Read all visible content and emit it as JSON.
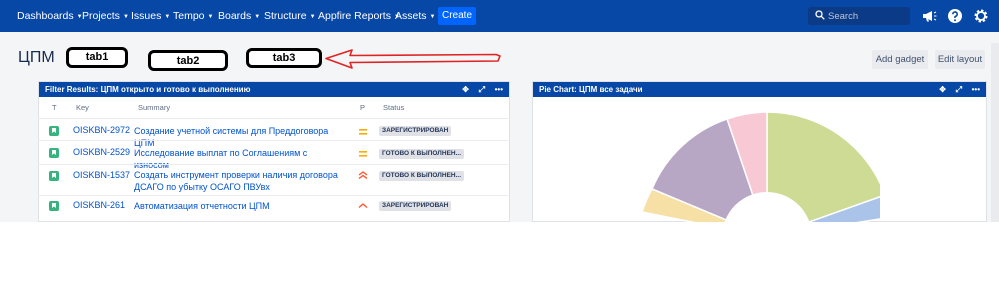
{
  "nav": {
    "items": [
      "Dashboards",
      "Projects",
      "Issues",
      "Tempo",
      "Boards",
      "Structure",
      "Appfire Reports",
      "Assets"
    ],
    "create_label": "Create",
    "search_placeholder": "Search"
  },
  "dashboard": {
    "title": "ЦПМ",
    "tabs": [
      "tab1",
      "tab2",
      "tab3"
    ],
    "add_gadget_label": "Add gadget",
    "edit_layout_label": "Edit layout"
  },
  "filter_gadget": {
    "title": "Filter Results: ЦПМ открыто и готово к выполнению",
    "columns": {
      "type": "T",
      "key": "Key",
      "summary": "Summary",
      "priority": "P",
      "status": "Status"
    },
    "rows": [
      {
        "key": "OISKBN-2972",
        "summary": "Создание учетной системы для Преддоговора ЦПМ",
        "status": "ЗАРЕГИСТРИРОВАН",
        "priority": "medium"
      },
      {
        "key": "OISKBN-2529",
        "summary": "Исследование выплат по Соглашениям с износом",
        "status": "ГОТОВО К ВЫПОЛНЕН...",
        "priority": "medium"
      },
      {
        "key": "OISKBN-1537",
        "summary": "Создать инструмент проверки наличия договора ДСАГО по убытку ОСАГО ПВУвх",
        "status": "ГОТОВО К ВЫПОЛНЕН...",
        "priority": "highest"
      },
      {
        "key": "OISKBN-261",
        "summary": "Автоматизация отчетности ЦПМ",
        "status": "ЗАРЕГИСТРИРОВАН",
        "priority": "high"
      }
    ]
  },
  "pie_gadget": {
    "title": "Pie Chart: ЦПМ все задачи"
  },
  "colors": {
    "nav_bg": "#0747a6",
    "create_bg": "#0065ff",
    "annotation_arrow": "#e02424",
    "pie_green": "#cddb94",
    "pie_purple": "#b7a6c4",
    "pie_pink": "#f8c8d4",
    "pie_yellow": "#f6e0a6",
    "pie_blue": "#a9c4e8"
  }
}
